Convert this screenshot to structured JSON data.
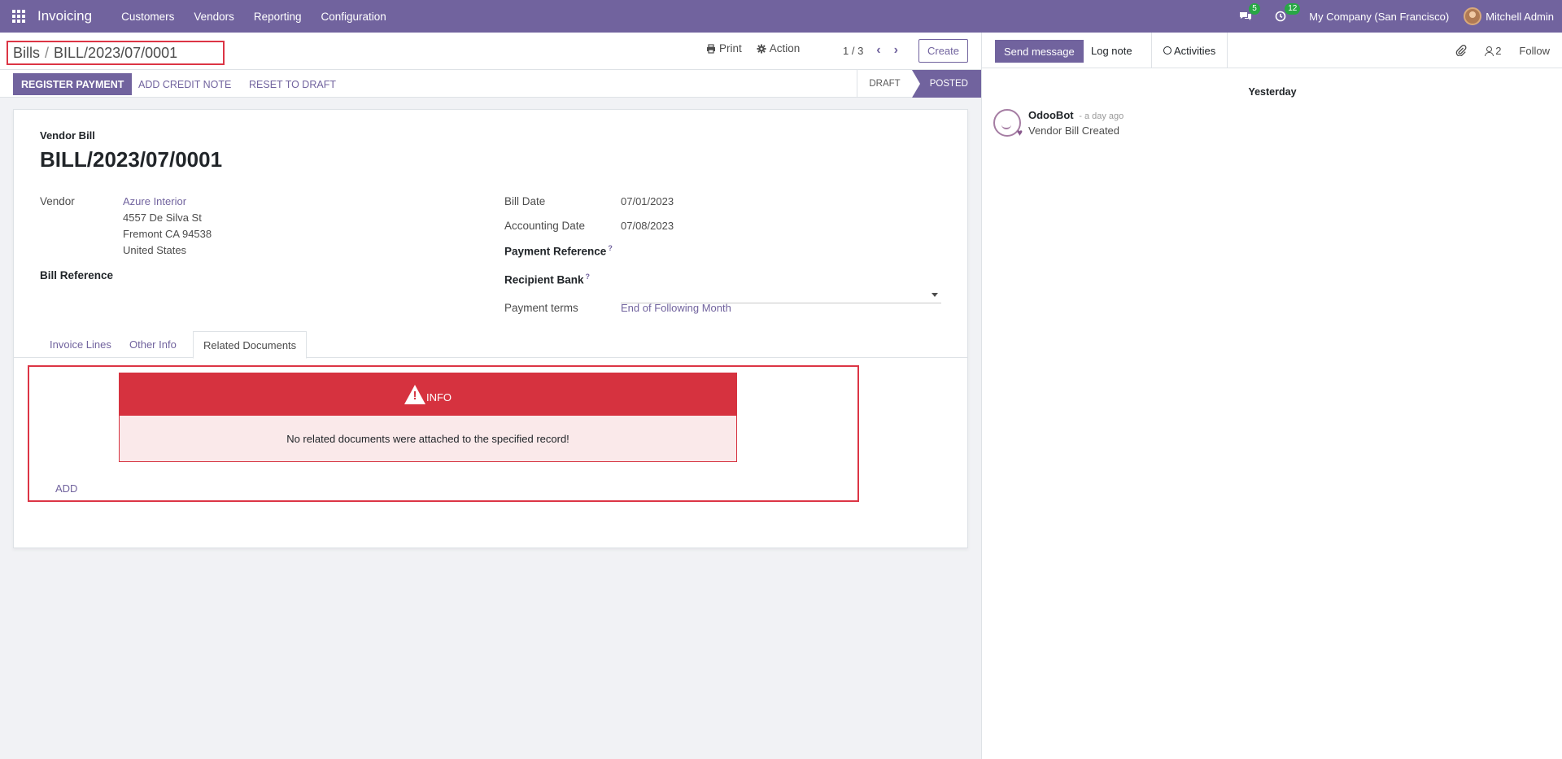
{
  "navbar": {
    "brand": "Invoicing",
    "menu": [
      "Customers",
      "Vendors",
      "Reporting",
      "Configuration"
    ],
    "messages_count": "5",
    "activities_count": "12",
    "company": "My Company (San Francisco)",
    "user": "Mitchell Admin"
  },
  "breadcrumb": {
    "parent": "Bills",
    "separator": "/",
    "current": "BILL/2023/07/0001"
  },
  "control": {
    "print": "Print",
    "action": "Action",
    "pager": "1 / 3",
    "create": "Create"
  },
  "buttons": {
    "register_payment": "Register Payment",
    "add_credit_note": "Add Credit Note",
    "reset_to_draft": "Reset to Draft"
  },
  "status": {
    "draft": "Draft",
    "posted": "Posted",
    "active": "Posted"
  },
  "form": {
    "doc_type": "Vendor Bill",
    "title": "BILL/2023/07/0001",
    "vendor_label": "Vendor",
    "vendor_name": "Azure Interior",
    "vendor_address": [
      "4557 De Silva St",
      "Fremont CA 94538",
      "United States"
    ],
    "bill_reference_label": "Bill Reference",
    "bill_date_label": "Bill Date",
    "bill_date": "07/01/2023",
    "accounting_date_label": "Accounting Date",
    "accounting_date": "07/08/2023",
    "payment_reference_label": "Payment Reference",
    "recipient_bank_label": "Recipient Bank",
    "recipient_bank_value": "",
    "payment_terms_label": "Payment terms",
    "payment_terms": "End of Following Month",
    "help_mark": "?"
  },
  "tabs": [
    {
      "label": "Invoice Lines"
    },
    {
      "label": "Other Info"
    },
    {
      "label": "Related Documents",
      "active": true
    }
  ],
  "related": {
    "alert_title": "INFO",
    "alert_message": "No related documents were attached to the specified record!",
    "add_label": "Add"
  },
  "chatter": {
    "send_message": "Send message",
    "log_note": "Log note",
    "activities": "Activities",
    "followers_count": "2",
    "follow": "Follow",
    "day_separator": "Yesterday",
    "messages": [
      {
        "author": "OdooBot",
        "date": "- a day ago",
        "body": "Vendor Bill Created"
      }
    ]
  },
  "colors": {
    "brand": "#71639e",
    "danger": "#d6323f",
    "highlight_border": "#dc3545",
    "badge": "#28a745"
  }
}
